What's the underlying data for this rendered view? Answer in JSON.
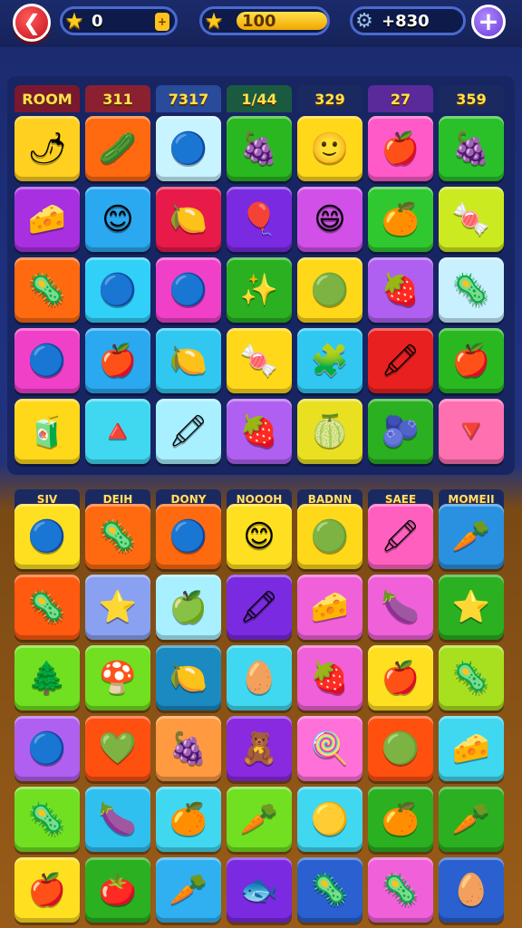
{
  "topbar": {
    "back_icon": "back-arrow-icon",
    "coins": {
      "value": "0",
      "icon": "star-icon",
      "tag": "+"
    },
    "stars": {
      "value": "100",
      "icon": "star-icon"
    },
    "gems": {
      "value": "+830",
      "icon": "gear-gem-icon"
    },
    "plus_label": "+"
  },
  "top_labels": [
    {
      "text": "ROOM",
      "bg": "#7a1830"
    },
    {
      "text": "311",
      "bg": "#8a2030"
    },
    {
      "text": "7317",
      "bg": "#2a4a9a"
    },
    {
      "text": "1/44",
      "bg": "#1a5a40"
    },
    {
      "text": "329",
      "bg": "#1a2a60"
    },
    {
      "text": "27",
      "bg": "#5a2a9a"
    },
    {
      "text": "359",
      "bg": "#1a2a60"
    }
  ],
  "bottom_labels": [
    "SIV",
    "DEIH",
    "DONY",
    "NOOOH",
    "BADNN",
    "SAEE",
    "MOMEII"
  ],
  "top_grid": [
    [
      {
        "c": "#ffd020",
        "i": "🌶"
      },
      {
        "c": "#ff6a10",
        "i": "🥒"
      },
      {
        "c": "#c8f4ff",
        "i": "🔵"
      },
      {
        "c": "#2ab820",
        "i": "🍇"
      },
      {
        "c": "#ffd81a",
        "i": "🙂"
      },
      {
        "c": "#ff5ac8",
        "i": "🍎"
      },
      {
        "c": "#2ac02a",
        "i": "🍇"
      }
    ],
    [
      {
        "c": "#a830e0",
        "i": "🧀"
      },
      {
        "c": "#2aa8f0",
        "i": "😊"
      },
      {
        "c": "#e81a4a",
        "i": "🍋"
      },
      {
        "c": "#7a2ae0",
        "i": "🎈"
      },
      {
        "c": "#d050e8",
        "i": "😄"
      },
      {
        "c": "#30c830",
        "i": "🍊"
      },
      {
        "c": "#ccea20",
        "i": "🍬"
      }
    ],
    [
      {
        "c": "#ff6a10",
        "i": "🦠"
      },
      {
        "c": "#30d0f8",
        "i": "🔵"
      },
      {
        "c": "#f040c8",
        "i": "🔵"
      },
      {
        "c": "#2ab020",
        "i": "✨"
      },
      {
        "c": "#ffd81a",
        "i": "🟢"
      },
      {
        "c": "#b060f0",
        "i": "🍓"
      },
      {
        "c": "#c8f0ff",
        "i": "🦠"
      }
    ],
    [
      {
        "c": "#f040c8",
        "i": "🔵"
      },
      {
        "c": "#2aa8f0",
        "i": "🍎"
      },
      {
        "c": "#30c8f0",
        "i": "🍋"
      },
      {
        "c": "#ffd81a",
        "i": "🍬"
      },
      {
        "c": "#30c8f0",
        "i": "🧩"
      },
      {
        "c": "#e82020",
        "i": "🖍"
      },
      {
        "c": "#2ab820",
        "i": "🍎"
      }
    ],
    [
      {
        "c": "#ffd81a",
        "i": "🧃"
      },
      {
        "c": "#40d8f0",
        "i": "🔺"
      },
      {
        "c": "#a8f0ff",
        "i": "🖍"
      },
      {
        "c": "#b060f0",
        "i": "🍓"
      },
      {
        "c": "#e8e020",
        "i": "🍈"
      },
      {
        "c": "#2ab020",
        "i": "🫐"
      },
      {
        "c": "#ff70b0",
        "i": "🔻"
      }
    ]
  ],
  "bottom_grid": [
    [
      {
        "c": "#ffe020",
        "i": "🔵"
      },
      {
        "c": "#ff6a10",
        "i": "🦠"
      },
      {
        "c": "#ff6a10",
        "i": "🔵"
      },
      {
        "c": "#ffe020",
        "i": "😊"
      },
      {
        "c": "#ffd81a",
        "i": "🟢"
      },
      {
        "c": "#ff60c0",
        "i": "🖍"
      },
      {
        "c": "#2a90e0",
        "i": "🥕"
      }
    ],
    [
      {
        "c": "#ff5a10",
        "i": "🦠"
      },
      {
        "c": "#8aa0f0",
        "i": "⭐"
      },
      {
        "c": "#a8f0ff",
        "i": "🍏"
      },
      {
        "c": "#7a2ae0",
        "i": "🖍"
      },
      {
        "c": "#f060d8",
        "i": "🧀"
      },
      {
        "c": "#f060d8",
        "i": "🍆"
      },
      {
        "c": "#2ab020",
        "i": "⭐"
      }
    ],
    [
      {
        "c": "#70e020",
        "i": "🌲"
      },
      {
        "c": "#70e020",
        "i": "🍄"
      },
      {
        "c": "#1a8ac0",
        "i": "🍋"
      },
      {
        "c": "#40d8f0",
        "i": "🥚"
      },
      {
        "c": "#f060d8",
        "i": "🍓"
      },
      {
        "c": "#ffe020",
        "i": "🍎"
      },
      {
        "c": "#a8e020",
        "i": "🦠"
      }
    ],
    [
      {
        "c": "#b060f0",
        "i": "🔵"
      },
      {
        "c": "#ff5010",
        "i": "💚"
      },
      {
        "c": "#ff9a40",
        "i": "🍇"
      },
      {
        "c": "#8a2ae0",
        "i": "🧸"
      },
      {
        "c": "#ff70d8",
        "i": "🍭"
      },
      {
        "c": "#ff5010",
        "i": "🟢"
      },
      {
        "c": "#40d8f0",
        "i": "🧀"
      }
    ],
    [
      {
        "c": "#70e020",
        "i": "🦠"
      },
      {
        "c": "#30c0f0",
        "i": "🍆"
      },
      {
        "c": "#40d8f0",
        "i": "🍊"
      },
      {
        "c": "#70e020",
        "i": "🥕"
      },
      {
        "c": "#40d8f0",
        "i": "🟡"
      },
      {
        "c": "#2ab020",
        "i": "🍊"
      },
      {
        "c": "#2ab020",
        "i": "🥕"
      }
    ],
    [
      {
        "c": "#ffe020",
        "i": "🍎"
      },
      {
        "c": "#2ab020",
        "i": "🍅"
      },
      {
        "c": "#30b0f0",
        "i": "🥕"
      },
      {
        "c": "#7a2ae0",
        "i": "🐟"
      },
      {
        "c": "#2a60d0",
        "i": "🦠"
      },
      {
        "c": "#f060d8",
        "i": "🦠"
      },
      {
        "c": "#2a60d0",
        "i": "🥚"
      }
    ]
  ]
}
